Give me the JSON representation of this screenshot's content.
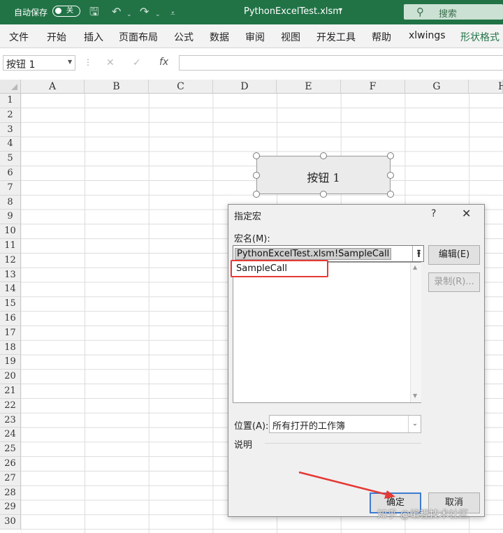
{
  "titlebar": {
    "autosave_label": "自动保存",
    "autosave_state": "关",
    "file_title": "PythonExcelTest.xlsm",
    "search_placeholder": "搜索"
  },
  "ribbon": {
    "tabs": [
      "文件",
      "开始",
      "插入",
      "页面布局",
      "公式",
      "数据",
      "审阅",
      "视图",
      "开发工具",
      "帮助",
      "xlwings",
      "形状格式"
    ]
  },
  "formula_bar": {
    "name_box": "按钮 1",
    "fx": "fx"
  },
  "grid": {
    "columns": [
      "A",
      "B",
      "C",
      "D",
      "E",
      "F",
      "G",
      "H"
    ],
    "rows": [
      "1",
      "2",
      "3",
      "4",
      "5",
      "6",
      "7",
      "8",
      "9",
      "10",
      "11",
      "12",
      "13",
      "14",
      "15",
      "16",
      "17",
      "18",
      "19",
      "20",
      "21",
      "22",
      "23",
      "24",
      "25",
      "26",
      "27",
      "28",
      "29",
      "30"
    ]
  },
  "form_button": {
    "label": "按钮 1"
  },
  "dialog": {
    "title": "指定宏",
    "help": "?",
    "close": "✕",
    "macro_name_label": "宏名(M):",
    "macro_name_value": "PythonExcelTest.xlsm!SampleCall",
    "macro_list": [
      "SampleCall"
    ],
    "edit_button": "编辑(E)",
    "record_button": "录制(R)...",
    "location_label": "位置(A):",
    "location_value": "所有打开的工作簿",
    "description_label": "说明",
    "ok_button": "确定",
    "cancel_button": "取消"
  },
  "colors": {
    "excel_green": "#217346",
    "highlight_red": "#e53935",
    "annotation_arrow": "#e53935"
  },
  "watermark": "知乎 @编程技术社区"
}
